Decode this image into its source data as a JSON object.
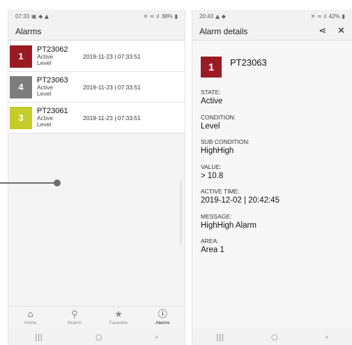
{
  "left": {
    "status": {
      "time": "07:33",
      "battery": "38%"
    },
    "appbar_title": "Alarms",
    "alarms": [
      {
        "priority": "1",
        "color": "#9b1b24",
        "tag": "PT23062",
        "state": "Active",
        "condition": "Level",
        "time": "2019-11-23 | 07:33:51"
      },
      {
        "priority": "4",
        "color": "#7d7d7d",
        "tag": "PT23063",
        "state": "Active",
        "condition": "Level",
        "time": "2019-11-23 | 07:33:51"
      },
      {
        "priority": "3",
        "color": "#c6cc2a",
        "tag": "PT23061",
        "state": "Active",
        "condition": "Level",
        "time": "2019-11-23 | 07:33:51"
      }
    ],
    "nav": [
      {
        "label": "Home",
        "icon": "home-icon",
        "active": false
      },
      {
        "label": "Search",
        "icon": "search-icon",
        "active": false
      },
      {
        "label": "Favorites",
        "icon": "star-icon",
        "active": false
      },
      {
        "label": "Alarms",
        "icon": "alarm-alert-icon",
        "active": true
      }
    ]
  },
  "right": {
    "status": {
      "time": "20:43",
      "battery": "42%"
    },
    "appbar_title": "Alarm details",
    "priority": "1",
    "priority_color": "#9b1b24",
    "tag": "PT23063",
    "fields": [
      {
        "label": "STATE:",
        "value": "Active"
      },
      {
        "label": "CONDITION:",
        "value": "Level"
      },
      {
        "label": "SUB CONDITION:",
        "value": "HighHigh"
      },
      {
        "label": "VALUE:",
        "value": "> 10.8"
      },
      {
        "label": "ACTIVE TIME:",
        "value": "2019-12-02 | 20:42:45"
      },
      {
        "label": "MESSAGE:",
        "value": "HighHigh Alarm"
      },
      {
        "label": "AREA:",
        "value": "Area 1"
      }
    ]
  },
  "colors": {
    "accent_dark": "#9b1b24",
    "slider": "#6e6e6e"
  }
}
